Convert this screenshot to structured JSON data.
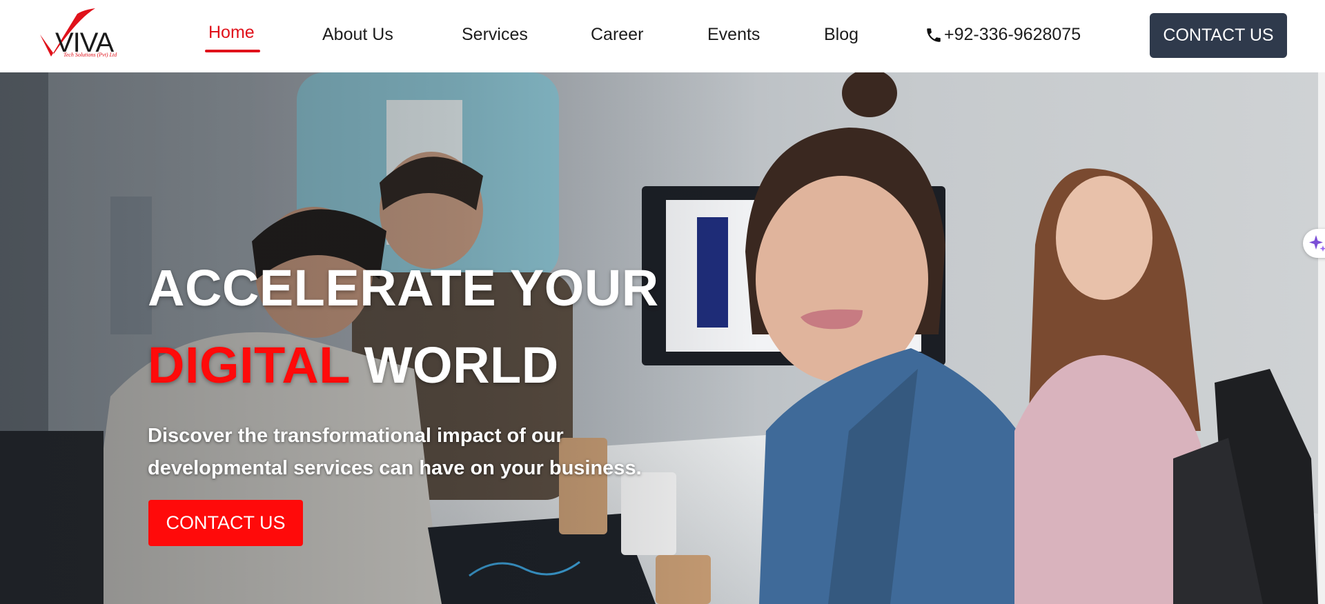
{
  "brand": {
    "logo_text": "VIVA",
    "tagline": "Tech Solutions (Pvt) Ltd",
    "accent_color": "#e0121b",
    "dark_color": "#2f3a4c"
  },
  "nav": {
    "items": [
      {
        "label": "Home",
        "active": true
      },
      {
        "label": "About Us",
        "active": false
      },
      {
        "label": "Services",
        "active": false
      },
      {
        "label": "Career",
        "active": false
      },
      {
        "label": "Events",
        "active": false
      },
      {
        "label": "Blog",
        "active": false
      }
    ],
    "phone": "+92-336-9628075",
    "phone_icon": "phone-icon",
    "cta_label": "CONTACT US"
  },
  "hero": {
    "headline_line1": "ACCELERATE YOUR",
    "headline_red": "DIGITAL",
    "headline_white": "WORLD",
    "subtext_line1": "Discover the transformational impact of our",
    "subtext_line2": "developmental services can have on your business.",
    "cta_label": "CONTACT US",
    "cta_color": "#ff0a0a"
  },
  "widgets": {
    "assistant_icon": "sparkle-icon"
  }
}
